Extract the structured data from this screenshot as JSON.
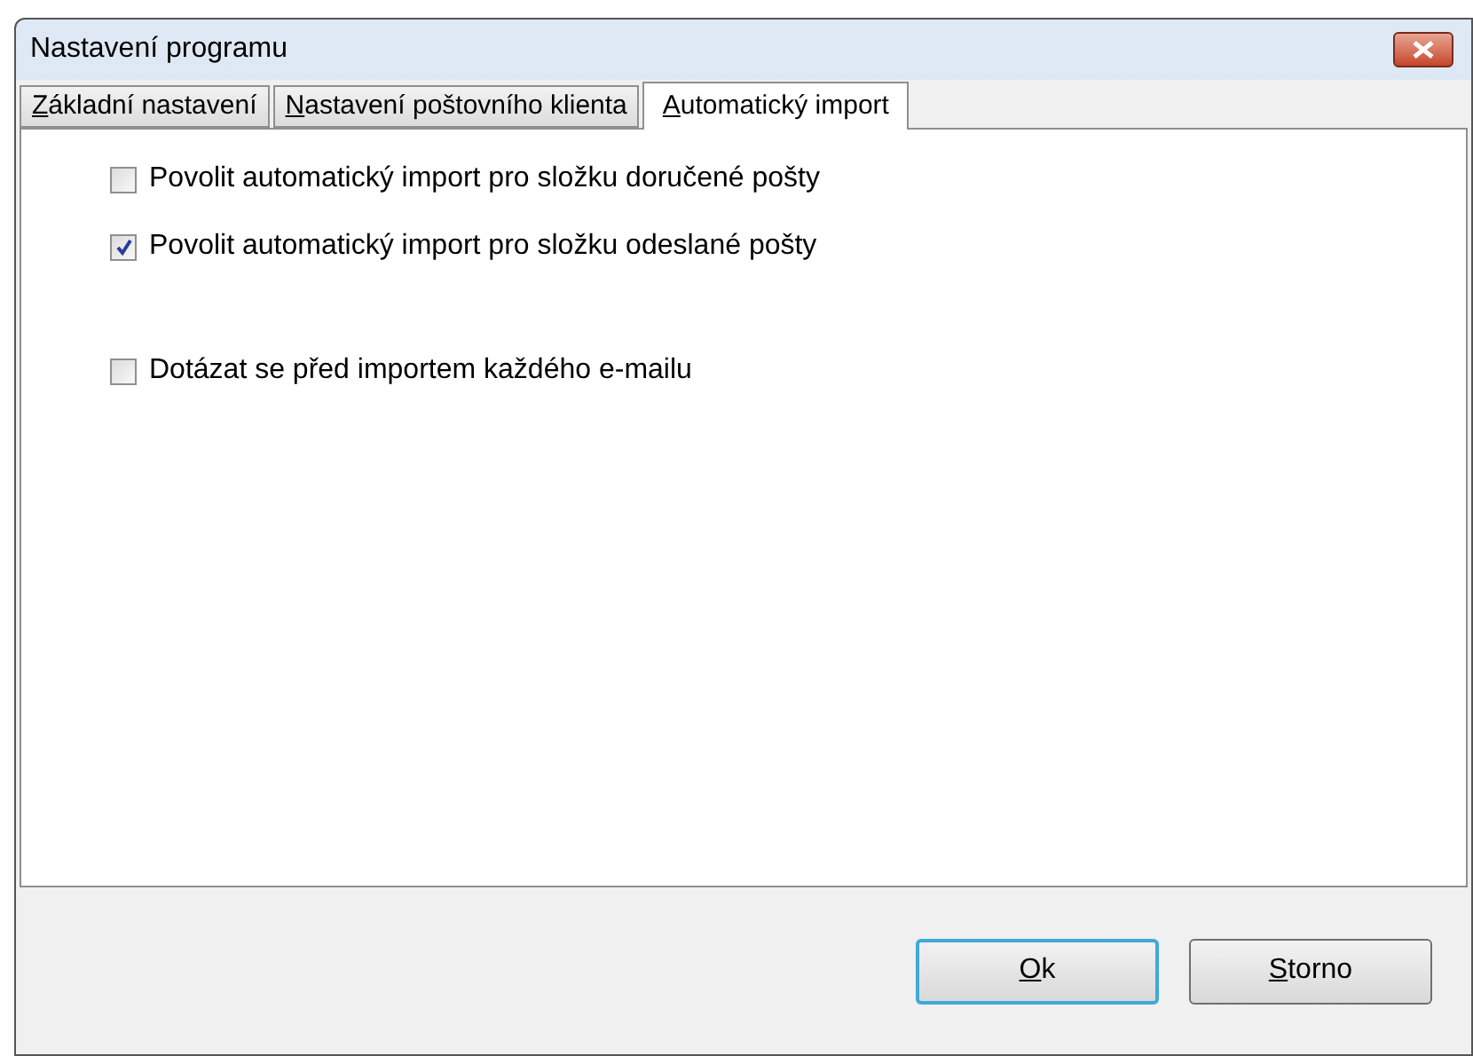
{
  "window": {
    "title": "Nastavení programu"
  },
  "tabs": [
    {
      "label": "Základní nastavení",
      "selected": false
    },
    {
      "label": "Nastavení poštovního klienta",
      "selected": false
    },
    {
      "label": "Automatický import",
      "selected": true
    }
  ],
  "options": [
    {
      "label": "Povolit automatický import pro složku doručené pošty",
      "checked": false
    },
    {
      "label": "Povolit automatický import pro složku odeslané pošty",
      "checked": true
    },
    {
      "label": "Dotázat se před importem každého e-mailu",
      "checked": false,
      "gap": true
    }
  ],
  "buttons": [
    {
      "label": "Ok",
      "default": true
    },
    {
      "label": "Storno",
      "default": false
    }
  ]
}
